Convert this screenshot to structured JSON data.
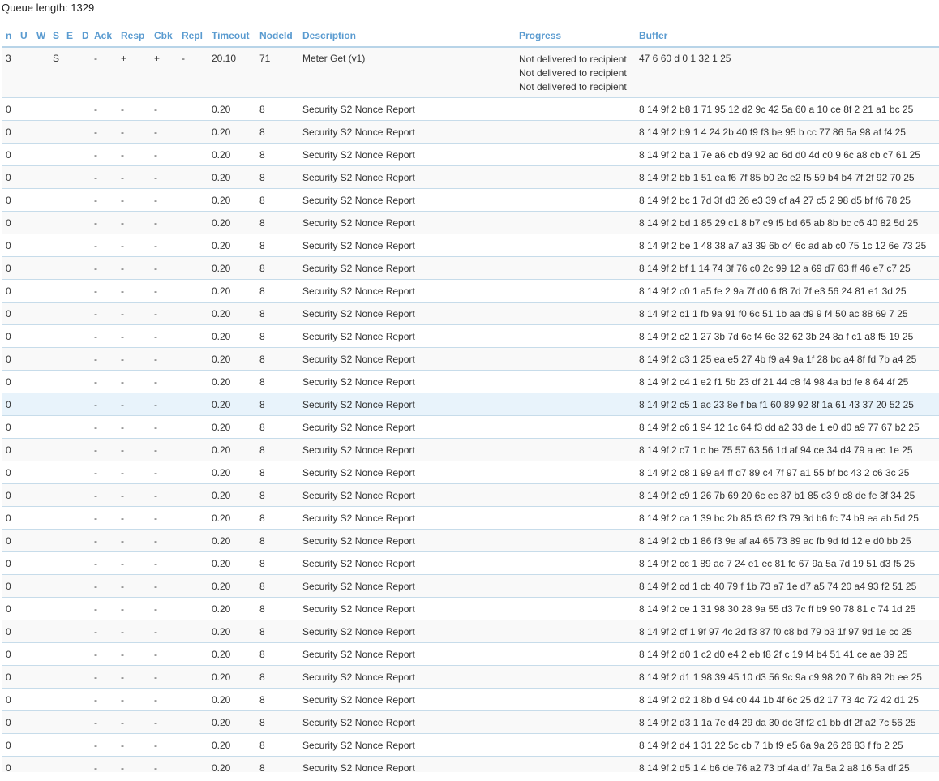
{
  "queue_length_text": "Queue length: 1329",
  "columns": [
    "n",
    "U",
    "W",
    "S",
    "E",
    "D",
    "Ack",
    "Resp",
    "Cbk",
    "Repl",
    "Timeout",
    "NodeId",
    "Description",
    "Progress",
    "Buffer"
  ],
  "first_row": {
    "n": "3",
    "u": "",
    "w": "",
    "s": "S",
    "e": "",
    "d": "",
    "ack": "-",
    "resp": "+",
    "cbk": "+",
    "repl": "-",
    "timeout": "20.10",
    "nodeid": "71",
    "description": "Meter Get (v1)",
    "progress": [
      "Not delivered to recipient",
      "Not delivered to recipient",
      "Not delivered to recipient"
    ],
    "buffer": "47 6 60 d 0 1 32 1 25"
  },
  "rows": [
    {
      "n": "0",
      "ack": "-",
      "resp": "-",
      "cbk": "-",
      "timeout": "0.20",
      "nodeid": "8",
      "description": "Security S2 Nonce Report",
      "buffer": "8 14 9f 2 b8 1 71 95 12 d2 9c 42 5a 60 a 10 ce 8f 2 21 a1 bc 25"
    },
    {
      "n": "0",
      "ack": "-",
      "resp": "-",
      "cbk": "-",
      "timeout": "0.20",
      "nodeid": "8",
      "description": "Security S2 Nonce Report",
      "buffer": "8 14 9f 2 b9 1 4 24 2b 40 f9 f3 be 95 b cc 77 86 5a 98 af f4 25"
    },
    {
      "n": "0",
      "ack": "-",
      "resp": "-",
      "cbk": "-",
      "timeout": "0.20",
      "nodeid": "8",
      "description": "Security S2 Nonce Report",
      "buffer": "8 14 9f 2 ba 1 7e a6 cb d9 92 ad 6d d0 4d c0 9 6c a8 cb c7 61 25"
    },
    {
      "n": "0",
      "ack": "-",
      "resp": "-",
      "cbk": "-",
      "timeout": "0.20",
      "nodeid": "8",
      "description": "Security S2 Nonce Report",
      "buffer": "8 14 9f 2 bb 1 51 ea f6 7f 85 b0 2c e2 f5 59 b4 b4 7f 2f 92 70 25"
    },
    {
      "n": "0",
      "ack": "-",
      "resp": "-",
      "cbk": "-",
      "timeout": "0.20",
      "nodeid": "8",
      "description": "Security S2 Nonce Report",
      "buffer": "8 14 9f 2 bc 1 7d 3f d3 26 e3 39 cf a4 27 c5 2 98 d5 bf f6 78 25"
    },
    {
      "n": "0",
      "ack": "-",
      "resp": "-",
      "cbk": "-",
      "timeout": "0.20",
      "nodeid": "8",
      "description": "Security S2 Nonce Report",
      "buffer": "8 14 9f 2 bd 1 85 29 c1 8 b7 c9 f5 bd 65 ab 8b bc c6 40 82 5d 25"
    },
    {
      "n": "0",
      "ack": "-",
      "resp": "-",
      "cbk": "-",
      "timeout": "0.20",
      "nodeid": "8",
      "description": "Security S2 Nonce Report",
      "buffer": "8 14 9f 2 be 1 48 38 a7 a3 39 6b c4 6c ad ab c0 75 1c 12 6e 73 25"
    },
    {
      "n": "0",
      "ack": "-",
      "resp": "-",
      "cbk": "-",
      "timeout": "0.20",
      "nodeid": "8",
      "description": "Security S2 Nonce Report",
      "buffer": "8 14 9f 2 bf 1 14 74 3f 76 c0 2c 99 12 a 69 d7 63 ff 46 e7 c7 25"
    },
    {
      "n": "0",
      "ack": "-",
      "resp": "-",
      "cbk": "-",
      "timeout": "0.20",
      "nodeid": "8",
      "description": "Security S2 Nonce Report",
      "buffer": "8 14 9f 2 c0 1 a5 fe 2 9a 7f d0 6 f8 7d 7f e3 56 24 81 e1 3d 25"
    },
    {
      "n": "0",
      "ack": "-",
      "resp": "-",
      "cbk": "-",
      "timeout": "0.20",
      "nodeid": "8",
      "description": "Security S2 Nonce Report",
      "buffer": "8 14 9f 2 c1 1 fb 9a 91 f0 6c 51 1b aa d9 9 f4 50 ac 88 69 7 25"
    },
    {
      "n": "0",
      "ack": "-",
      "resp": "-",
      "cbk": "-",
      "timeout": "0.20",
      "nodeid": "8",
      "description": "Security S2 Nonce Report",
      "buffer": "8 14 9f 2 c2 1 27 3b 7d 6c f4 6e 32 62 3b 24 8a f c1 a8 f5 19 25"
    },
    {
      "n": "0",
      "ack": "-",
      "resp": "-",
      "cbk": "-",
      "timeout": "0.20",
      "nodeid": "8",
      "description": "Security S2 Nonce Report",
      "buffer": "8 14 9f 2 c3 1 25 ea e5 27 4b f9 a4 9a 1f 28 bc a4 8f fd 7b a4 25"
    },
    {
      "n": "0",
      "ack": "-",
      "resp": "-",
      "cbk": "-",
      "timeout": "0.20",
      "nodeid": "8",
      "description": "Security S2 Nonce Report",
      "buffer": "8 14 9f 2 c4 1 e2 f1 5b 23 df 21 44 c8 f4 98 4a bd fe 8 64 4f 25"
    },
    {
      "n": "0",
      "ack": "-",
      "resp": "-",
      "cbk": "-",
      "timeout": "0.20",
      "nodeid": "8",
      "description": "Security S2 Nonce Report",
      "buffer": "8 14 9f 2 c5 1 ac 23 8e f ba f1 60 89 92 8f 1a 61 43 37 20 52 25",
      "highlight": true
    },
    {
      "n": "0",
      "ack": "-",
      "resp": "-",
      "cbk": "-",
      "timeout": "0.20",
      "nodeid": "8",
      "description": "Security S2 Nonce Report",
      "buffer": "8 14 9f 2 c6 1 94 12 1c 64 f3 dd a2 33 de 1 e0 d0 a9 77 67 b2 25"
    },
    {
      "n": "0",
      "ack": "-",
      "resp": "-",
      "cbk": "-",
      "timeout": "0.20",
      "nodeid": "8",
      "description": "Security S2 Nonce Report",
      "buffer": "8 14 9f 2 c7 1 c be 75 57 63 56 1d af 94 ce 34 d4 79 a ec 1e 25"
    },
    {
      "n": "0",
      "ack": "-",
      "resp": "-",
      "cbk": "-",
      "timeout": "0.20",
      "nodeid": "8",
      "description": "Security S2 Nonce Report",
      "buffer": "8 14 9f 2 c8 1 99 a4 ff d7 89 c4 7f 97 a1 55 bf bc 43 2 c6 3c 25"
    },
    {
      "n": "0",
      "ack": "-",
      "resp": "-",
      "cbk": "-",
      "timeout": "0.20",
      "nodeid": "8",
      "description": "Security S2 Nonce Report",
      "buffer": "8 14 9f 2 c9 1 26 7b 69 20 6c ec 87 b1 85 c3 9 c8 de fe 3f 34 25"
    },
    {
      "n": "0",
      "ack": "-",
      "resp": "-",
      "cbk": "-",
      "timeout": "0.20",
      "nodeid": "8",
      "description": "Security S2 Nonce Report",
      "buffer": "8 14 9f 2 ca 1 39 bc 2b 85 f3 62 f3 79 3d b6 fc 74 b9 ea ab 5d 25"
    },
    {
      "n": "0",
      "ack": "-",
      "resp": "-",
      "cbk": "-",
      "timeout": "0.20",
      "nodeid": "8",
      "description": "Security S2 Nonce Report",
      "buffer": "8 14 9f 2 cb 1 86 f3 9e af a4 65 73 89 ac fb 9d fd 12 e d0 bb 25"
    },
    {
      "n": "0",
      "ack": "-",
      "resp": "-",
      "cbk": "-",
      "timeout": "0.20",
      "nodeid": "8",
      "description": "Security S2 Nonce Report",
      "buffer": "8 14 9f 2 cc 1 89 ac 7 24 e1 ec 81 fc 67 9a 5a 7d 19 51 d3 f5 25"
    },
    {
      "n": "0",
      "ack": "-",
      "resp": "-",
      "cbk": "-",
      "timeout": "0.20",
      "nodeid": "8",
      "description": "Security S2 Nonce Report",
      "buffer": "8 14 9f 2 cd 1 cb 40 79 f 1b 73 a7 1e d7 a5 74 20 a4 93 f2 51 25"
    },
    {
      "n": "0",
      "ack": "-",
      "resp": "-",
      "cbk": "-",
      "timeout": "0.20",
      "nodeid": "8",
      "description": "Security S2 Nonce Report",
      "buffer": "8 14 9f 2 ce 1 31 98 30 28 9a 55 d3 7c ff b9 90 78 81 c 74 1d 25"
    },
    {
      "n": "0",
      "ack": "-",
      "resp": "-",
      "cbk": "-",
      "timeout": "0.20",
      "nodeid": "8",
      "description": "Security S2 Nonce Report",
      "buffer": "8 14 9f 2 cf 1 9f 97 4c 2d f3 87 f0 c8 bd 79 b3 1f 97 9d 1e cc 25"
    },
    {
      "n": "0",
      "ack": "-",
      "resp": "-",
      "cbk": "-",
      "timeout": "0.20",
      "nodeid": "8",
      "description": "Security S2 Nonce Report",
      "buffer": "8 14 9f 2 d0 1 c2 d0 e4 2 eb f8 2f c 19 f4 b4 51 41 ce ae 39 25"
    },
    {
      "n": "0",
      "ack": "-",
      "resp": "-",
      "cbk": "-",
      "timeout": "0.20",
      "nodeid": "8",
      "description": "Security S2 Nonce Report",
      "buffer": "8 14 9f 2 d1 1 98 39 45 10 d3 56 9c 9a c9 98 20 7 6b 89 2b ee 25"
    },
    {
      "n": "0",
      "ack": "-",
      "resp": "-",
      "cbk": "-",
      "timeout": "0.20",
      "nodeid": "8",
      "description": "Security S2 Nonce Report",
      "buffer": "8 14 9f 2 d2 1 8b d 94 c0 44 1b 4f 6c 25 d2 17 73 4c 72 42 d1 25"
    },
    {
      "n": "0",
      "ack": "-",
      "resp": "-",
      "cbk": "-",
      "timeout": "0.20",
      "nodeid": "8",
      "description": "Security S2 Nonce Report",
      "buffer": "8 14 9f 2 d3 1 1a 7e d4 29 da 30 dc 3f f2 c1 bb df 2f a2 7c 56 25"
    },
    {
      "n": "0",
      "ack": "-",
      "resp": "-",
      "cbk": "-",
      "timeout": "0.20",
      "nodeid": "8",
      "description": "Security S2 Nonce Report",
      "buffer": "8 14 9f 2 d4 1 31 22 5c cb 7 1b f9 e5 6a 9a 26 26 83 f fb 2 25"
    },
    {
      "n": "0",
      "ack": "-",
      "resp": "-",
      "cbk": "-",
      "timeout": "0.20",
      "nodeid": "8",
      "description": "Security S2 Nonce Report",
      "buffer": "8 14 9f 2 d5 1 4 b6 de 76 a2 73 bf 4a df 7a 5a 2 a8 16 5a df 25"
    }
  ]
}
